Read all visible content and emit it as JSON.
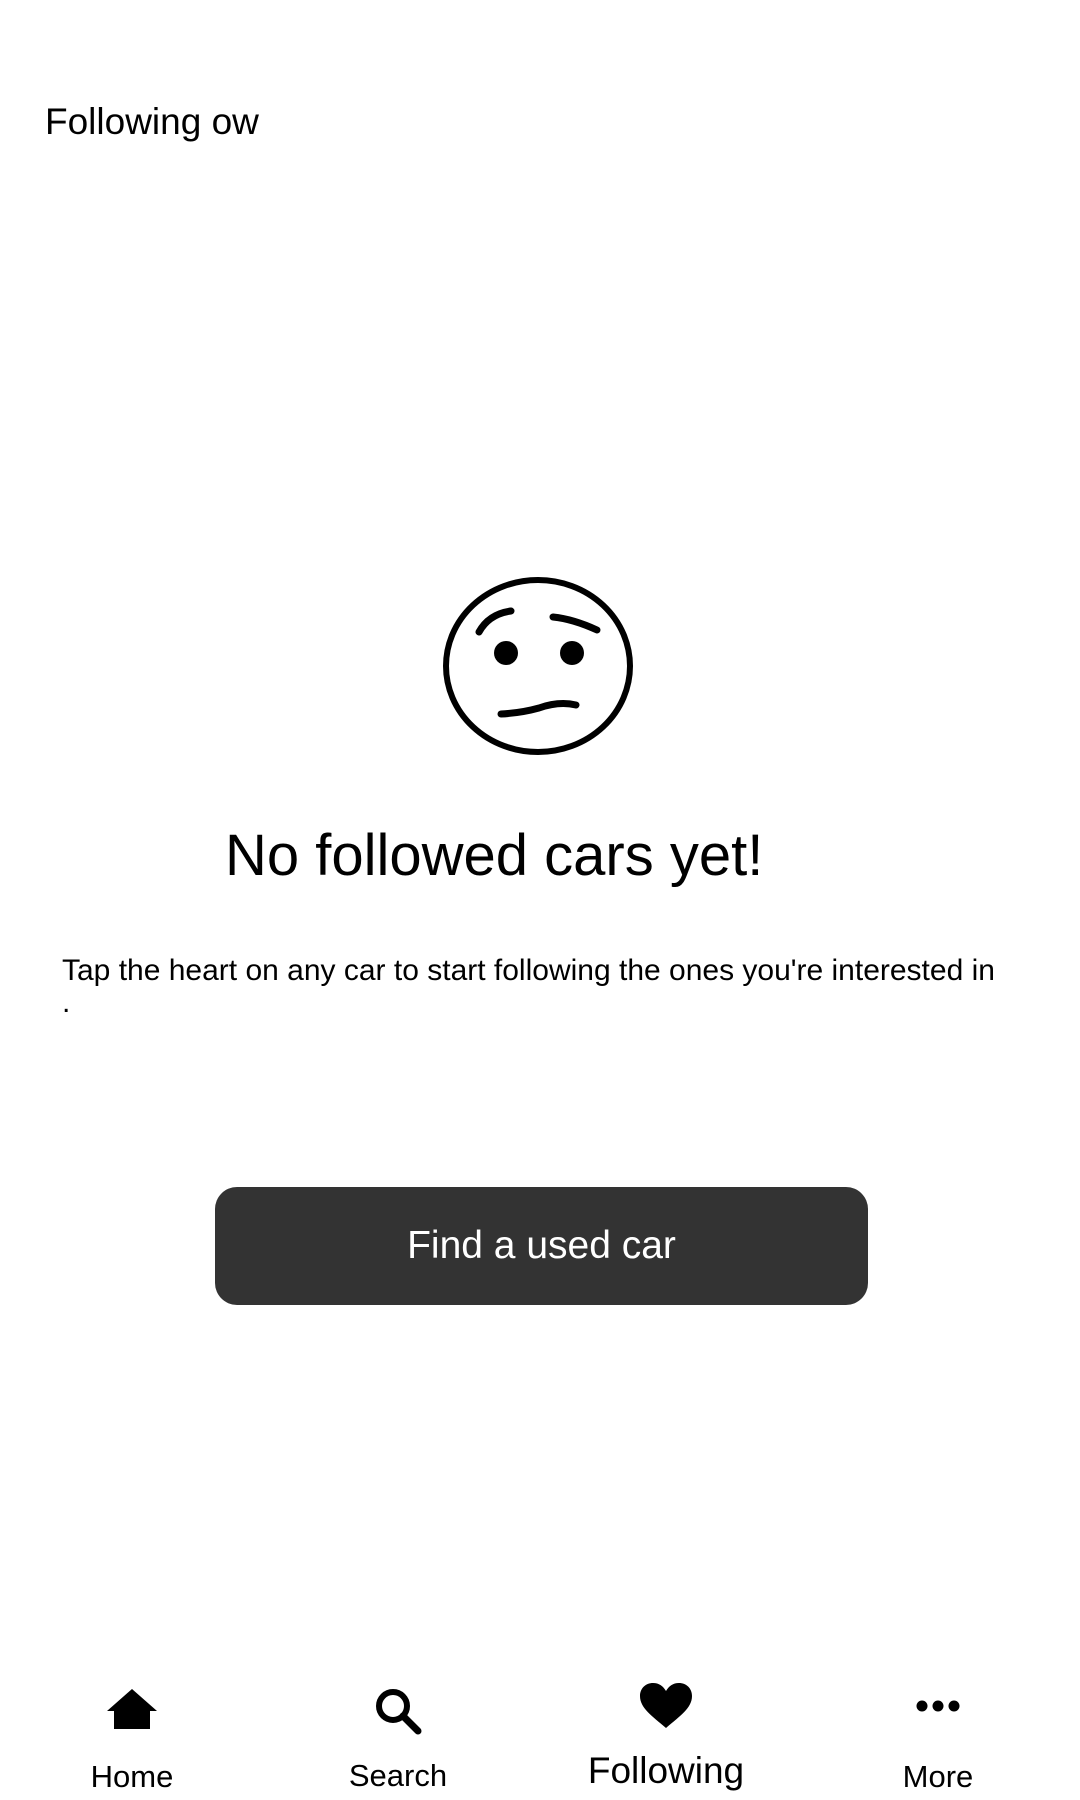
{
  "header": {
    "title": "Following ow"
  },
  "empty_state": {
    "icon": "worried-face-icon",
    "title": "No followed cars yet!",
    "message": "Tap the heart on any car to start following the ones you're interested in",
    "message_trailing": ".",
    "button_label": "Find a used car"
  },
  "bottom_nav": {
    "items": [
      {
        "label": "Home",
        "icon": "home-icon"
      },
      {
        "label": "Search",
        "icon": "search-icon"
      },
      {
        "label": "Following",
        "icon": "heart-icon",
        "active": true
      },
      {
        "label": "More",
        "icon": "more-dots-icon"
      }
    ]
  },
  "colors": {
    "background": "#ffffff",
    "text": "#000000",
    "button_bg": "#333333",
    "button_text": "#ffffff"
  }
}
